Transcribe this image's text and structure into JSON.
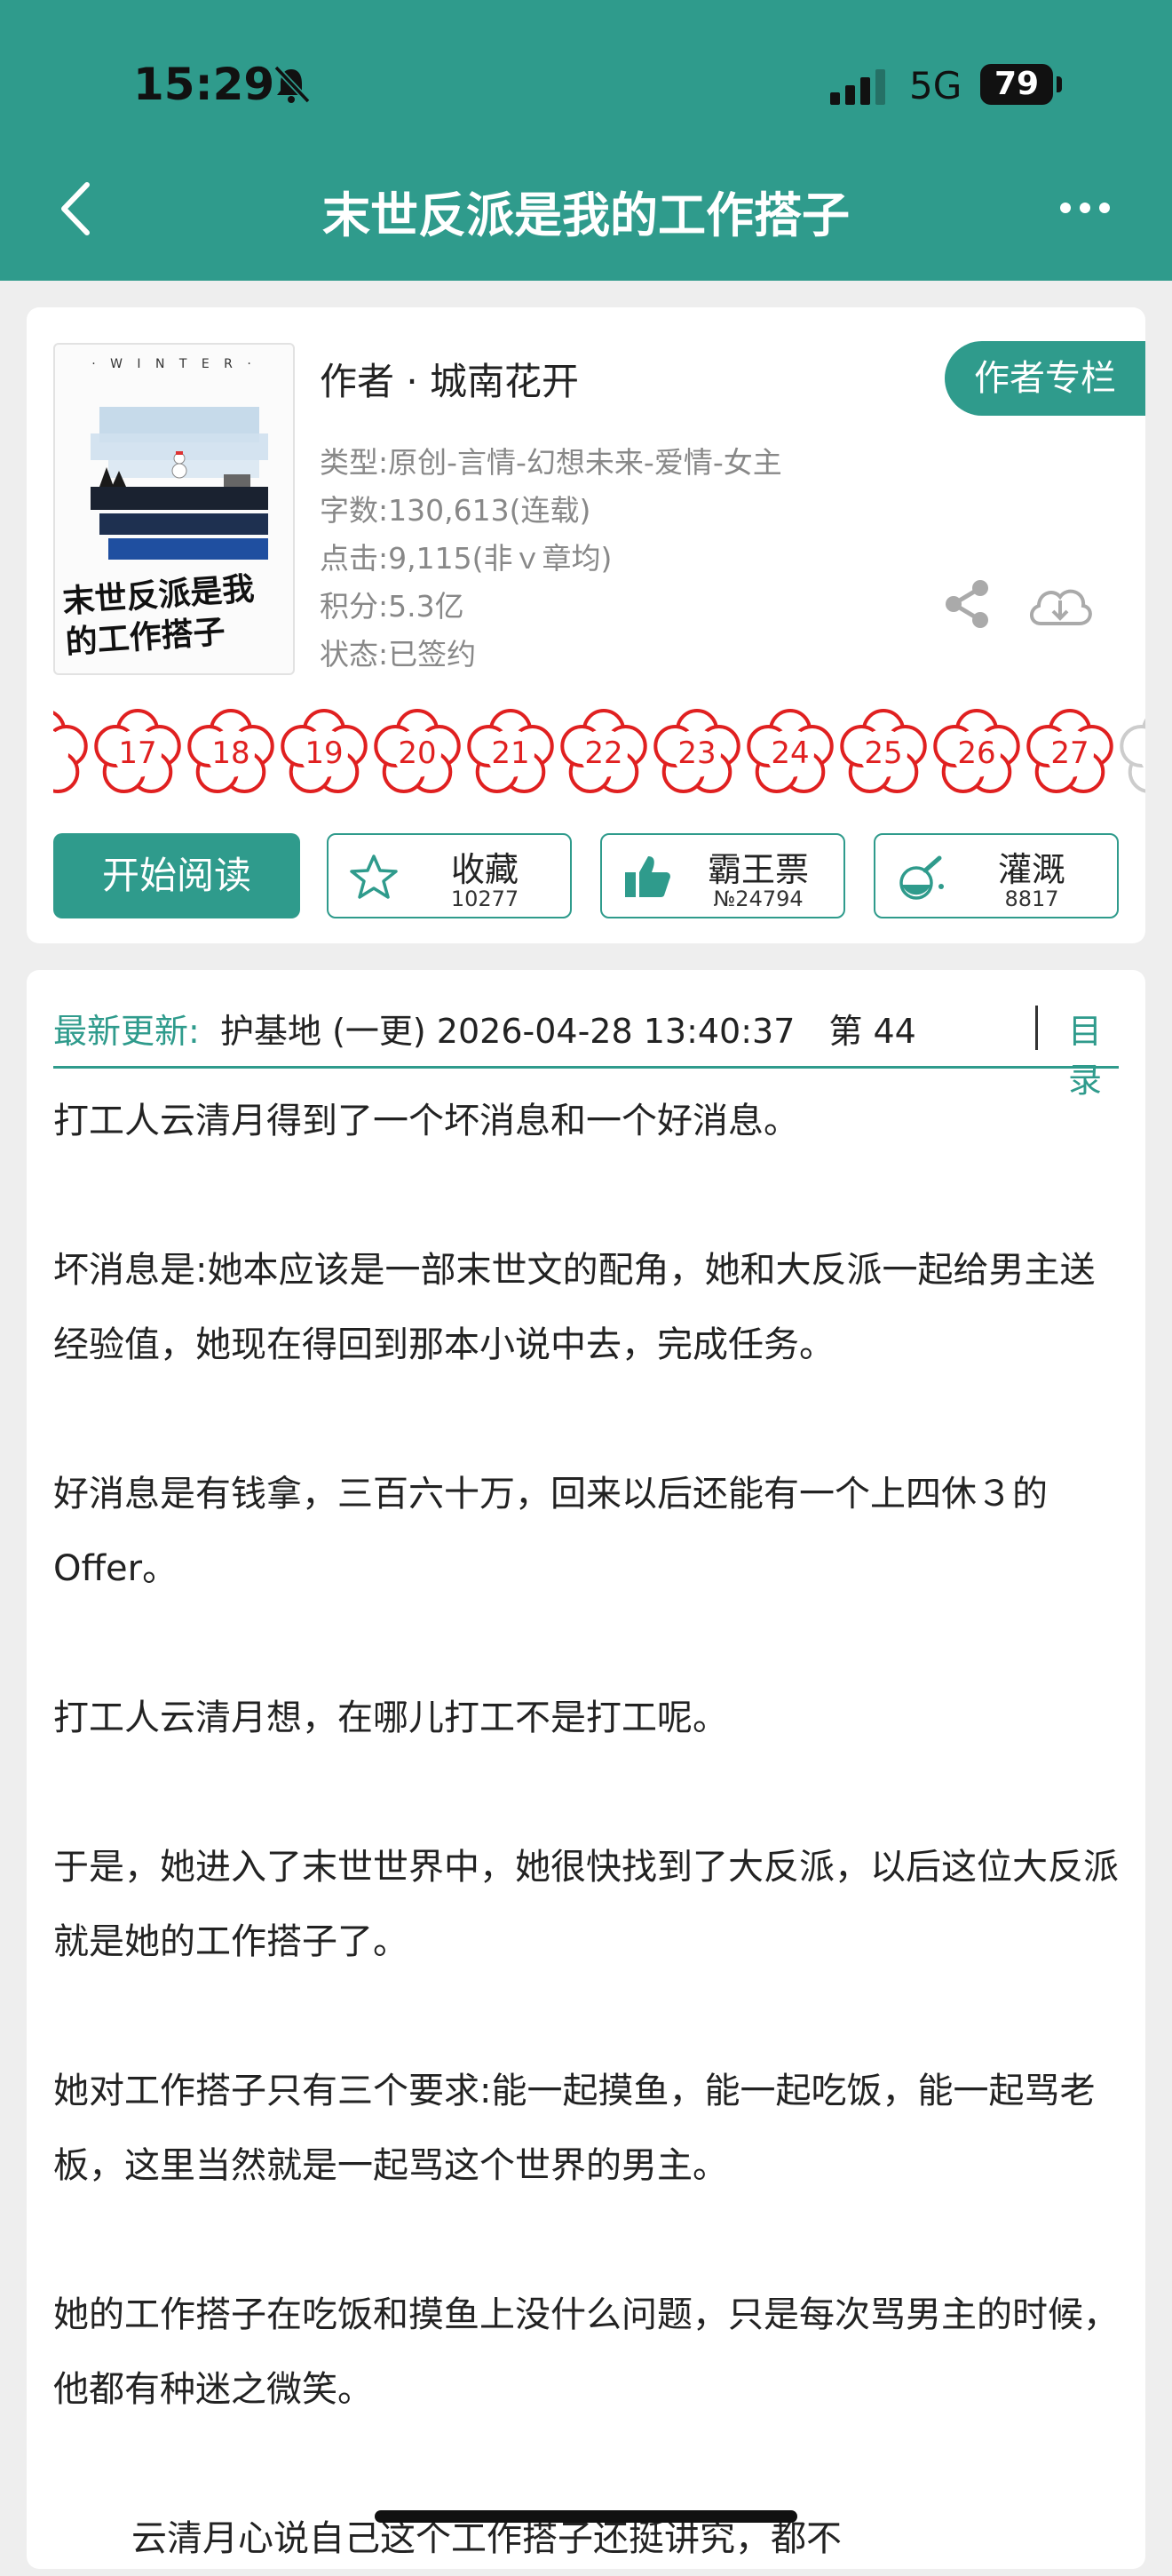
{
  "status_bar": {
    "time": "15:29",
    "network": "5G",
    "battery": "79"
  },
  "nav": {
    "title": "末世反派是我的工作搭子"
  },
  "book": {
    "cover_label": "· W I N T E R ·",
    "cover_title": "末世反派是我的工作搭子",
    "author": "作者 · 城南花开",
    "author_tag": "作者专栏",
    "info": [
      "类型:原创-言情-幻想未来-爱情-女主",
      "字数:130,613(连载)",
      "点击:9,115(非ｖ章均)",
      "积分:5.3亿",
      "状态:已签约"
    ],
    "flowers": [
      "",
      "17",
      "18",
      "19",
      "20",
      "21",
      "22",
      "23",
      "24",
      "25",
      "26",
      "27",
      ""
    ],
    "start_button": "开始阅读",
    "actions": [
      {
        "label": "收藏",
        "count": "10277",
        "icon": "star-icon"
      },
      {
        "label": "霸王票",
        "count": "№24794",
        "icon": "thumbs-up-icon"
      },
      {
        "label": "灌溉",
        "count": "8817",
        "icon": "nutrient-bottle-icon"
      }
    ]
  },
  "latest": {
    "label": "最新更新:",
    "text": "护基地 (一更) 2026-04-28 13:40:37　第 44",
    "toc": "目录"
  },
  "paragraphs": [
    "打工人云清月得到了一个坏消息和一个好消息。",
    "坏消息是:她本应该是一部末世文的配角，她和大反派一起给男主送经验值，她现在得回到那本小说中去，完成任务。",
    "好消息是有钱拿，三百六十万，回来以后还能有一个上四休３的Offer。",
    "打工人云清月想，在哪儿打工不是打工呢。",
    "于是，她进入了末世世界中，她很快找到了大反派，以后这位大反派就是她的工作搭子了。",
    "她对工作搭子只有三个要求:能一起摸鱼，能一起吃饭，能一起骂老板，这里当然就是一起骂这个世界的男主。",
    "她的工作搭子在吃饭和摸鱼上没什么问题，只是每次骂男主的时候，他都有种迷之微笑。",
    "云清月心说自己这个工作搭子还挺讲究，都不"
  ],
  "colors": {
    "accent": "#2f9b8c",
    "flower": "#e02020"
  }
}
